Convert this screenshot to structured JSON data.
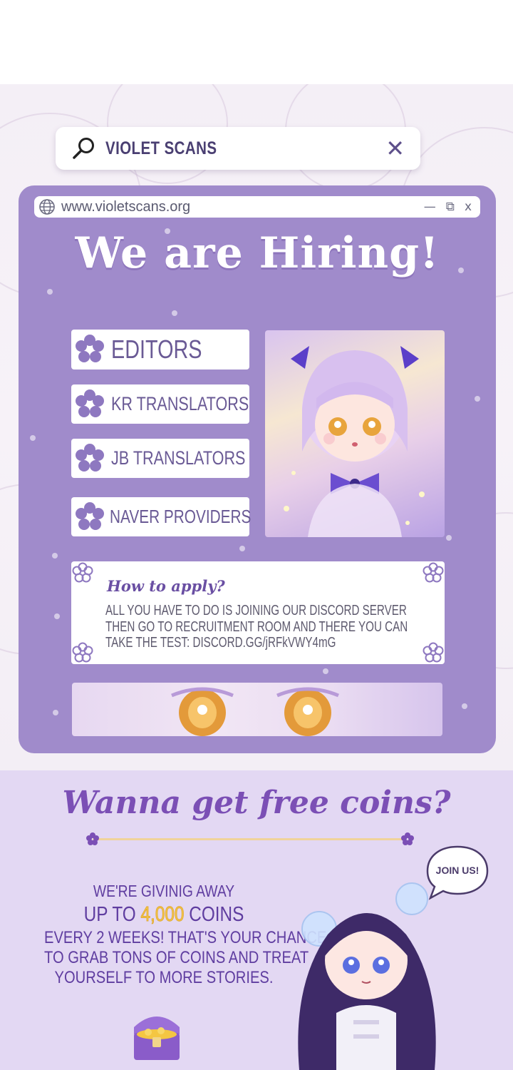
{
  "search": {
    "query": "VIOLET SCANS",
    "search_icon": "magnifier-icon",
    "close_label": "✕"
  },
  "window": {
    "url": "www.violetscans.org",
    "controls": {
      "minimize": "—",
      "restore": "⧉",
      "close": "x"
    },
    "title": "We are Hiring!",
    "roles": [
      "EDITORS",
      "KR TRANSLATORS",
      "JB TRANSLATORS",
      "NAVER PROVIDERS"
    ],
    "apply": {
      "title": "How to apply?",
      "lines": [
        "ALL YOU HAVE TO DO IS JOINING OUR DISCORD SERVER",
        "THEN GO TO RECRUITMENT ROOM AND THERE YOU CAN",
        "TAKE THE TEST: DISCORD.GG/jRFkVWY4mG"
      ]
    }
  },
  "promo": {
    "title": "Wanna get free coins?",
    "bubble": "JOIN US!",
    "line1": "WE'RE GIVINIG AWAY",
    "line2_pre": "UP TO",
    "line2_amount": "4,000",
    "line2_post": "COINS",
    "line3": "EVERY 2 WEEKS! THAT'S YOUR CHANCE",
    "line4": "TO GRAB TONS OF COINS AND TREAT",
    "line5": "YOURSELF TO MORE STORIES."
  },
  "colors": {
    "window_bg": "#a08bcb",
    "accent_purple": "#6a4fa3",
    "promo_bg": "#e3d8f3",
    "coin_gold": "#f6c84b"
  }
}
